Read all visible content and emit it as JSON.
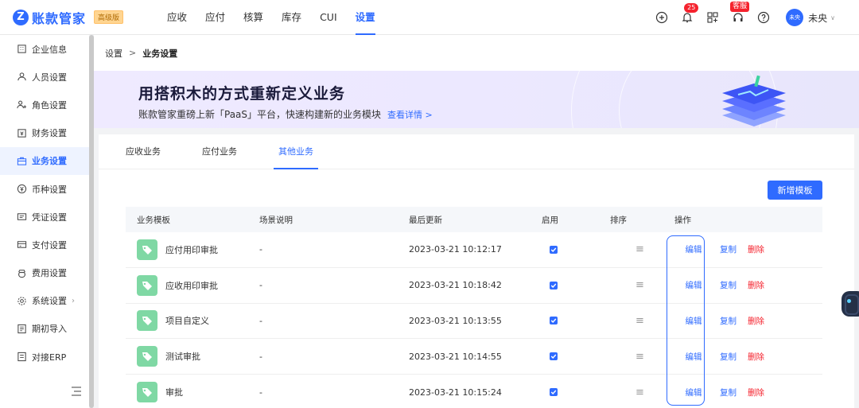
{
  "header": {
    "logo_mark": "Z",
    "logo_text": "账款管家",
    "edition_badge": "高级版",
    "nav": [
      {
        "label": "应收"
      },
      {
        "label": "应付"
      },
      {
        "label": "核算"
      },
      {
        "label": "库存"
      },
      {
        "label": "CUI"
      },
      {
        "label": "设置",
        "active": true
      }
    ],
    "notification_count": "25",
    "service_badge": "客服",
    "avatar_text": "未央",
    "user_name": "未央"
  },
  "sidebar": {
    "items": [
      {
        "label": "企业信息",
        "icon": "building-icon"
      },
      {
        "label": "人员设置",
        "icon": "user-icon"
      },
      {
        "label": "角色设置",
        "icon": "users-icon"
      },
      {
        "label": "财务设置",
        "icon": "finance-icon"
      },
      {
        "label": "业务设置",
        "icon": "briefcase-icon",
        "active": true
      },
      {
        "label": "币种设置",
        "icon": "currency-icon"
      },
      {
        "label": "凭证设置",
        "icon": "voucher-icon"
      },
      {
        "label": "支付设置",
        "icon": "payment-icon"
      },
      {
        "label": "费用设置",
        "icon": "expense-icon"
      },
      {
        "label": "系统设置",
        "icon": "system-icon",
        "has_arrow": true
      },
      {
        "label": "期初导入",
        "icon": "import-icon"
      },
      {
        "label": "对接ERP",
        "icon": "erp-icon"
      }
    ]
  },
  "breadcrumb": {
    "root": "设置",
    "separator": ">",
    "current": "业务设置"
  },
  "banner": {
    "title": "用搭积木的方式重新定义业务",
    "subtitle": "账款管家重磅上新「PaaS」平台，快速构建新的业务模块",
    "link": "查看详情 >"
  },
  "tabs": [
    {
      "label": "应收业务"
    },
    {
      "label": "应付业务"
    },
    {
      "label": "其他业务",
      "active": true
    }
  ],
  "add_button": "新增模板",
  "table": {
    "columns": [
      "业务模板",
      "场景说明",
      "最后更新",
      "启用",
      "排序",
      "操作"
    ],
    "rows": [
      {
        "name": "应付用印审批",
        "desc": "-",
        "updated": "2023-03-21 10:12:17",
        "enabled": true
      },
      {
        "name": "应收用印审批",
        "desc": "-",
        "updated": "2023-03-21 10:18:42",
        "enabled": true
      },
      {
        "name": "项目自定义",
        "desc": "-",
        "updated": "2023-03-21 10:13:55",
        "enabled": true
      },
      {
        "name": "测试审批",
        "desc": "-",
        "updated": "2023-03-21 10:14:55",
        "enabled": true
      },
      {
        "name": "审批",
        "desc": "-",
        "updated": "2023-03-21 10:15:24",
        "enabled": true
      }
    ],
    "actions": {
      "edit": "编辑",
      "copy": "复制",
      "delete": "删除"
    }
  },
  "colors": {
    "primary": "#2f6bff",
    "danger": "#f5222d",
    "tag_icon": "#7fd8a4"
  }
}
